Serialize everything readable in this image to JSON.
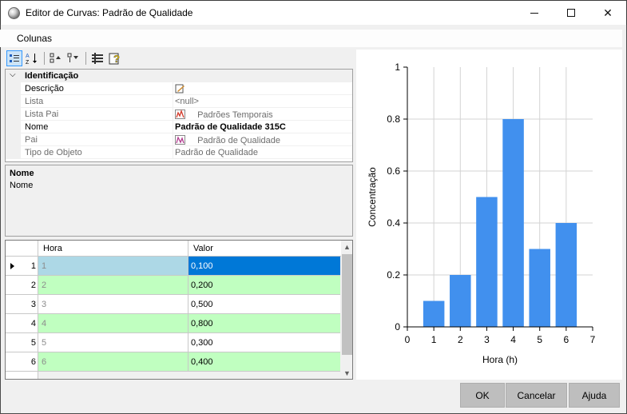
{
  "window": {
    "title": "Editor de Curvas: Padrão de Qualidade"
  },
  "menu": {
    "columns": "Colunas"
  },
  "toolbar": {
    "sort_az_label": "AZ"
  },
  "properties": {
    "category": "Identificação",
    "rows": [
      {
        "name": "Descrição",
        "value": ""
      },
      {
        "name": "Lista",
        "value": "<null>"
      },
      {
        "name": "Lista Pai",
        "value": "Padrões Temporais"
      },
      {
        "name": "Nome",
        "value": "Padrão de Qualidade 315C"
      },
      {
        "name": "Pai",
        "value": "Padrão de Qualidade"
      },
      {
        "name": "Tipo de Objeto",
        "value": "Padrão de Qualidade"
      }
    ]
  },
  "help": {
    "title": "Nome",
    "description": "Nome"
  },
  "grid": {
    "columns": [
      "Hora",
      "Valor"
    ],
    "rows": [
      {
        "index": "1",
        "hora": "1",
        "valor": "0,100"
      },
      {
        "index": "2",
        "hora": "2",
        "valor": "0,200"
      },
      {
        "index": "3",
        "hora": "3",
        "valor": "0,500"
      },
      {
        "index": "4",
        "hora": "4",
        "valor": "0,800"
      },
      {
        "index": "5",
        "hora": "5",
        "valor": "0,300"
      },
      {
        "index": "6",
        "hora": "6",
        "valor": "0,400"
      }
    ]
  },
  "chart_data": {
    "type": "bar",
    "x": [
      1,
      2,
      3,
      4,
      5,
      6
    ],
    "values": [
      0.1,
      0.2,
      0.5,
      0.8,
      0.3,
      0.4
    ],
    "xlabel": "Hora (h)",
    "ylabel": "Concentração",
    "xlim": [
      0,
      7
    ],
    "ylim": [
      0,
      1
    ],
    "xticks": [
      "0",
      "1",
      "2",
      "3",
      "4",
      "5",
      "6",
      "7"
    ],
    "yticks": [
      "0",
      "0.2",
      "0.4",
      "0.6",
      "0.8",
      "1"
    ],
    "grid": true,
    "bar_color": "#4190ee"
  },
  "buttons": {
    "ok": "OK",
    "cancel": "Cancelar",
    "help": "Ajuda"
  },
  "colors": {
    "row_selected": "#add8e6",
    "row_alt": "#c0ffc0",
    "cell_selected": "#0078d7",
    "button_bg": "#bebebe"
  }
}
